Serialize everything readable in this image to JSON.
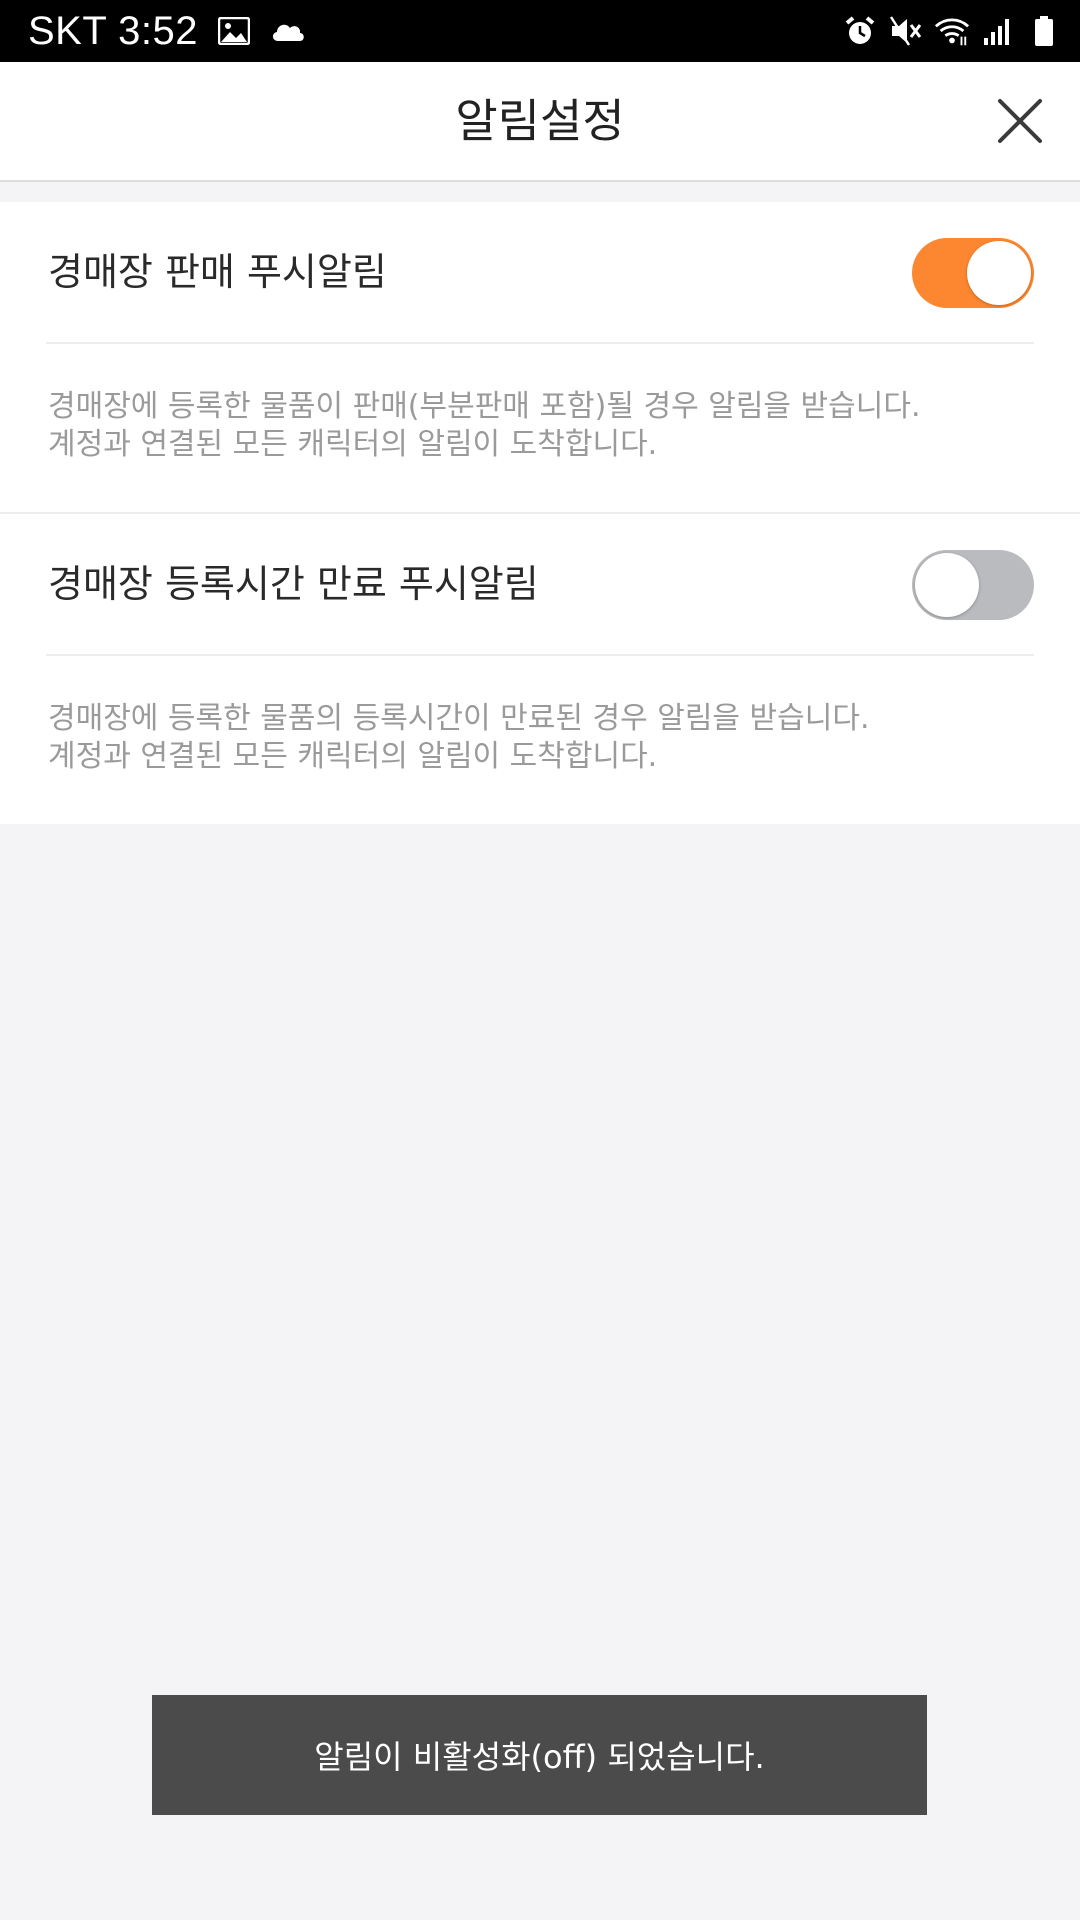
{
  "status_bar": {
    "carrier_time": "SKT 3:52",
    "left_icons": [
      "image-icon",
      "cloud-icon"
    ],
    "right_icons": [
      "alarm-icon",
      "mute-icon",
      "wifi-icon",
      "signal-icon",
      "battery-icon"
    ]
  },
  "header": {
    "title": "알림설정",
    "close_icon": "close-icon"
  },
  "settings": [
    {
      "label": "경매장 판매 푸시알림",
      "enabled": true,
      "description": [
        "경매장에 등록한 물품이 판매(부분판매 포함)될 경우 알림을 받습니다.",
        "계정과 연결된 모든 캐릭터의 알림이 도착합니다."
      ]
    },
    {
      "label": "경매장 등록시간 만료 푸시알림",
      "enabled": false,
      "description": [
        "경매장에 등록한 물품의 등록시간이 만료된 경우 알림을 받습니다.",
        "계정과 연결된 모든 캐릭터의 알림이 도착합니다."
      ]
    }
  ],
  "toast": {
    "message": "알림이 비활성화(off) 되었습니다."
  },
  "colors": {
    "accent": "#fd8730",
    "toggle_off": "#b9bbbe",
    "toast_bg": "#4b4b4b",
    "page_bg": "#f4f4f6"
  }
}
